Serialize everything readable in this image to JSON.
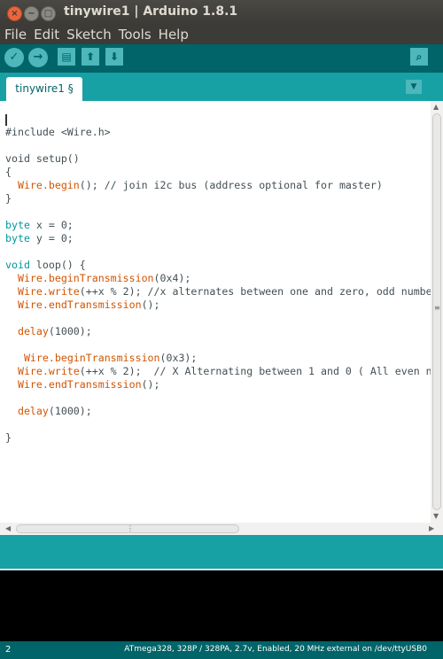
{
  "window": {
    "title": "tinywire1 | Arduino 1.8.1",
    "close_glyph": "×",
    "minimize_glyph": "−",
    "maximize_glyph": "□"
  },
  "menu": [
    "File",
    "Edit",
    "Sketch",
    "Tools",
    "Help"
  ],
  "toolbar": {
    "verify_icon": "✓",
    "upload_icon": "→",
    "new_icon": "▤",
    "open_icon": "⬆",
    "save_icon": "⬇",
    "serial_monitor_icon": "⌕"
  },
  "tabs": {
    "active": "tinywire1 §",
    "menu_icon": "▼"
  },
  "code": {
    "line1": "#include <Wire.h>",
    "line3": "void setup()",
    "line4": "{",
    "line5_fn": "Wire.begin",
    "line5_rest": "(); // join i2c bus (address optional for master)",
    "line6": "}",
    "line8_kw": "byte",
    "line8_rest": " x = 0;",
    "line9_kw": "byte",
    "line9_rest": " y = 0;",
    "line11_kw": "void",
    "line11_rest": " loop() {",
    "line12_fn": "Wire.beginTransmission",
    "line12_rest": "(0x4);",
    "line13_fn": "Wire.write",
    "line13_rest": "(++x % 2); //x alternates between one and zero, odd numbe",
    "line14_fn": "Wire.endTransmission",
    "line14_rest": "();",
    "line16_fn": "delay",
    "line16_rest": "(1000);",
    "line18_fn": "Wire.beginTransmission",
    "line18_rest": "(0x3);",
    "line19_fn": "Wire.write",
    "line19_rest": "(++x % 2);  // X Alternating between 1 and 0 ( All even n",
    "line20_fn": "Wire.endTransmission",
    "line20_rest": "();",
    "line22_fn": "delay",
    "line22_rest": "(1000);",
    "line24": "}"
  },
  "scrollbar": {
    "up": "▲",
    "down": "▼",
    "left": "◀",
    "right": "▶",
    "grip_h": "⋮",
    "grip_v": "≡"
  },
  "footer": {
    "line_number": "2",
    "board": "ATmega328, 328P / 328PA, 2.7v, Enabled, 20 MHz external on /dev/ttyUSB0"
  }
}
